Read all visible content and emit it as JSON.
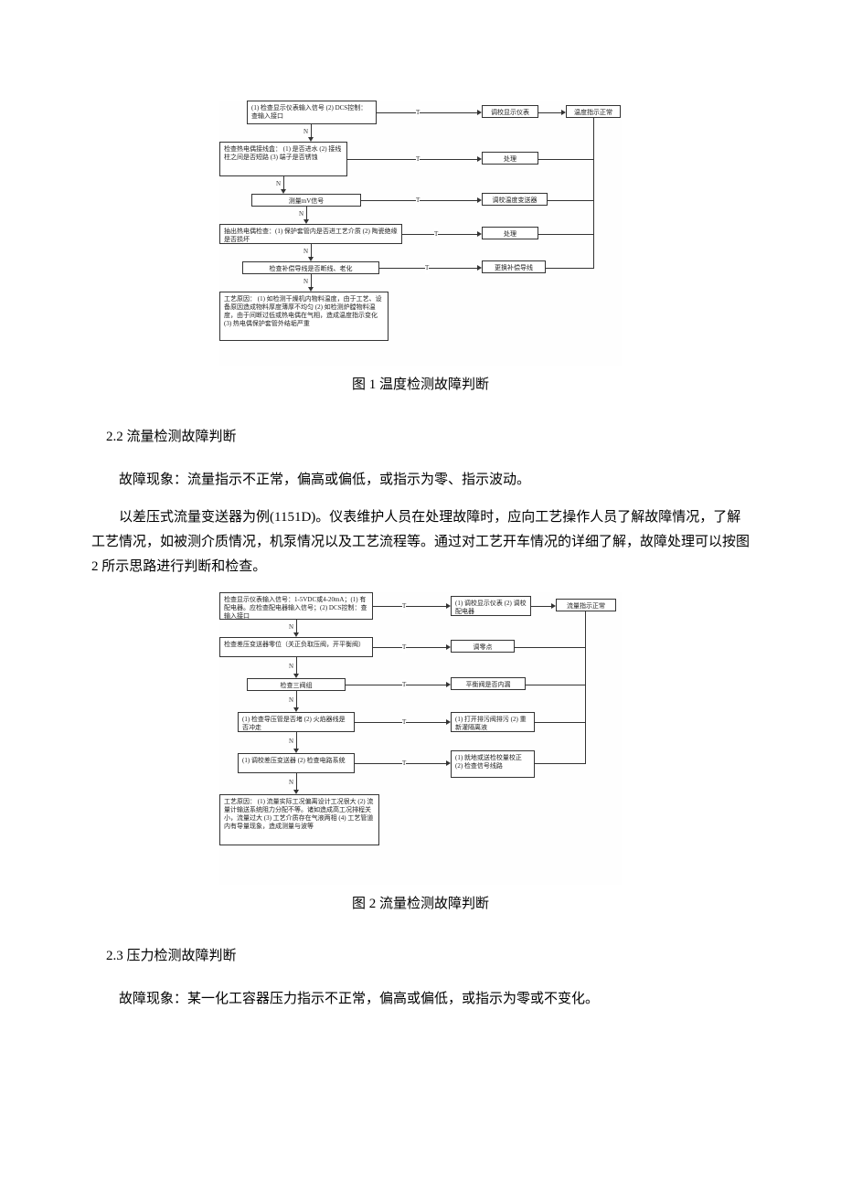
{
  "figure1": {
    "caption": "图 1 温度检测故障判断",
    "flow": {
      "boxes": {
        "b1": "(1) 检查显示仪表输入信号\n(2) DCS控制：查输入接口",
        "b1out": "调校显示仪表",
        "b1final": "温度指示正常",
        "b2": "检查热电偶接线盒：\n(1) 是否进水\n(2) 接线柱之间是否短路\n(3) 端子是否锈蚀",
        "b2out": "处理",
        "b3": "测量mV信号",
        "b3out": "调校温度变送器",
        "b4": "抽出热电偶检查：(1) 保护套管内是否进工艺介质\n(2) 陶瓷绝缘是否损坏",
        "b4out": "处理",
        "b5": "检查补偿导线是否断线、老化",
        "b5out": "更换补偿导线",
        "b6": "工艺原因：\n(1) 如检测干燥机内物料温度，由于工艺、设备原因造成物料厚度薄厚不均匀\n(2) 如检测炉膛物料温度，由于间断过低或热电偶在气相，造成温度指示变化\n(3) 热电偶保护套管外结垢严重"
      },
      "labels": {
        "T": "T",
        "N": "N"
      }
    }
  },
  "section22": {
    "title": "2.2 流量检测故障判断",
    "p1": "故障现象：流量指示不正常，偏高或偏低，或指示为零、指示波动。",
    "p2": "以差压式流量变送器为例(1151D)。仪表维护人员在处理故障时，应向工艺操作人员了解故障情况，了解工艺情况，如被测介质情况，机泵情况以及工艺流程等。通过对工艺开车情况的详细了解，故障处理可以按图 2 所示思路进行判断和检查。"
  },
  "figure2": {
    "caption": "图 2 流量检测故障判断",
    "flow": {
      "boxes": {
        "b1": "检查显示仪表输入信号：1-5VDC或4-20mA；(1) 有配电器。应检查配电器输入信号；(2) DCS控制：查输入接口",
        "b1out": "(1) 调校显示仪表\n(2) 调校配电器",
        "b1final": "流量指示正常",
        "b2": "检查差压变送器零位（关正负取压阀，开平衡阀）",
        "b2out": "调零点",
        "b3": "检查三阀组",
        "b3out": "平衡阀是否内漏",
        "b4": "(1) 检查导压管是否堵\n(2) 火焰器线是否冲走",
        "b4out": "(1) 打开排污阀排污\n(2) 重新灌隔离液",
        "b5": "(1) 调校差压变送器\n(2) 检查电路系统",
        "b5out": "(1) 就地或送检校量校正\n(2) 检查信号线路",
        "b6": "工艺原因：\n(1) 流量实际工况偏离设计工况很大\n(2) 流量计输送系统阻力分配不等。诸如造成高工况排程关小，流量过大 (3) 工艺介质存在气液两相 (4) 工艺管道内有导量现象，造成测量与波等"
      },
      "labels": {
        "T": "T",
        "N": "N"
      }
    }
  },
  "section23": {
    "title": "2.3 压力检测故障判断",
    "p1": "故障现象：某一化工容器压力指示不正常，偏高或偏低，或指示为零或不变化。"
  }
}
